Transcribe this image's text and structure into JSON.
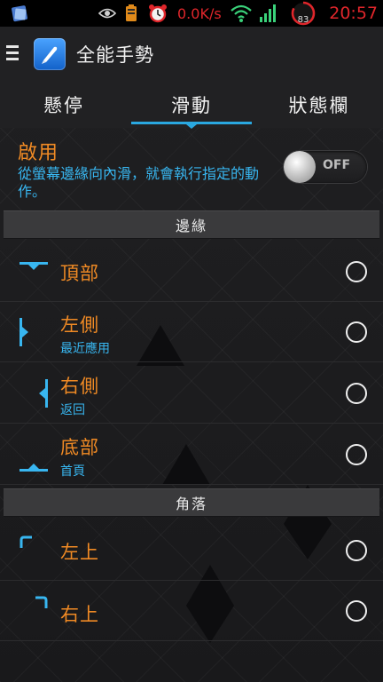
{
  "status_bar": {
    "network_speed": "0.0K/s",
    "battery_level": "83",
    "time": "20:57",
    "icons": [
      "app-notification-icon",
      "eye-icon",
      "battery-saver-icon",
      "alarm-clock-icon",
      "wifi-icon",
      "signal-icon",
      "battery-icon"
    ]
  },
  "action_bar": {
    "title": "全能手勢",
    "menu_icon": "hamburger-icon",
    "app_icon": "app-logo-icon"
  },
  "tabs": [
    {
      "label": "懸停",
      "selected": false
    },
    {
      "label": "滑動",
      "selected": true
    },
    {
      "label": "狀態欄",
      "selected": false
    }
  ],
  "enable": {
    "title": "啟用",
    "description": "從螢幕邊緣向內滑，就會執行指定的動作。",
    "toggle_label": "OFF",
    "toggle_on": false
  },
  "sections": {
    "edges": "邊緣",
    "corners": "角落"
  },
  "edges": [
    {
      "title": "頂部",
      "subtitle": "",
      "icon": "top-edge-icon",
      "selected": false
    },
    {
      "title": "左側",
      "subtitle": "最近應用",
      "icon": "left-edge-icon",
      "selected": false
    },
    {
      "title": "右側",
      "subtitle": "返回",
      "icon": "right-edge-icon",
      "selected": false
    },
    {
      "title": "底部",
      "subtitle": "首頁",
      "icon": "bottom-edge-icon",
      "selected": false
    }
  ],
  "corners": [
    {
      "title": "左上",
      "subtitle": "",
      "icon": "top-left-corner-icon",
      "selected": false
    },
    {
      "title": "右上",
      "subtitle": "",
      "icon": "top-right-corner-icon",
      "selected": false
    }
  ],
  "colors": {
    "accent_orange": "#f08a24",
    "accent_blue": "#38b6f0",
    "tab_indicator": "#2aa8e0",
    "status_red": "#e0262b"
  }
}
